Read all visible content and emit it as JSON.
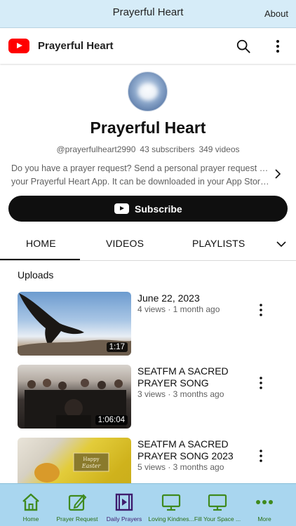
{
  "app": {
    "title": "Prayerful Heart",
    "about_label": "About"
  },
  "youtube_header": {
    "channel_name": "Prayerful Heart",
    "logo_icon": "youtube-logo-icon",
    "search_icon": "search-icon",
    "more_icon": "more-vert-icon"
  },
  "channel": {
    "name": "Prayerful Heart",
    "handle": "@prayerfulheart2990",
    "subscribers": "43 subscribers",
    "videos": "349 videos",
    "description_line1": "Do you have a prayer request? Send a personal prayer request with",
    "description_line2": "your Prayerful Heart App. It can be downloaded in your App Store...",
    "subscribe_label": "Subscribe"
  },
  "tabs": [
    {
      "label": "HOME",
      "active": true
    },
    {
      "label": "VIDEOS",
      "active": false
    },
    {
      "label": "PLAYLISTS",
      "active": false
    }
  ],
  "uploads_heading": "Uploads",
  "videos": [
    {
      "title_line1": "June 22, 2023",
      "title_line2": "",
      "meta": "4 views · 1 month ago",
      "duration": "1:17"
    },
    {
      "title_line1": "SEATFM A SACRED",
      "title_line2": "PRAYER SONG",
      "meta": "3 views · 3 months ago",
      "duration": "1:06:04"
    },
    {
      "title_line1": "SEATFM A SACRED",
      "title_line2": "PRAYER SONG 2023",
      "meta": "5 views · 3 months ago",
      "duration": ""
    }
  ],
  "bottom_nav": [
    {
      "label": "Home",
      "icon": "home-icon",
      "active": false
    },
    {
      "label": "Prayer Request",
      "icon": "pencil-note-icon",
      "active": false
    },
    {
      "label": "Daily Prayers",
      "icon": "video-playlist-icon",
      "active": true
    },
    {
      "label": "Loving Kindnes...",
      "icon": "monitor-icon",
      "active": false
    },
    {
      "label": "Fill Your Space ...",
      "icon": "monitor-icon",
      "active": false
    },
    {
      "label": "More",
      "icon": "more-horiz-icon",
      "active": false
    }
  ],
  "colors": {
    "appbar_bg": "#d6ecf8",
    "bottombar_bg": "#a9d6ef",
    "nav_icon": "#3f8a1e",
    "nav_active": "#3f1c6e",
    "youtube_red": "#ff0000"
  }
}
